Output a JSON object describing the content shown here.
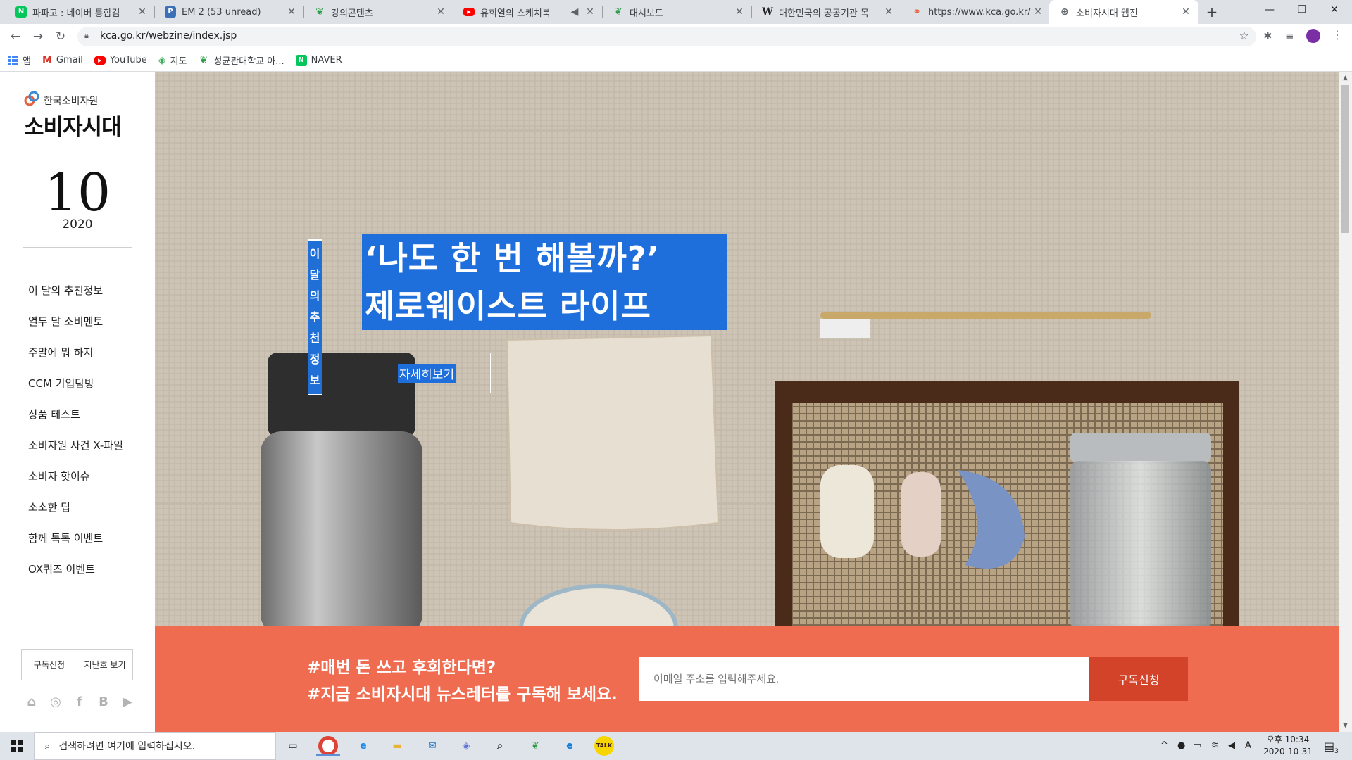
{
  "browser": {
    "tabs": [
      {
        "title": "파파고 : 네이버 통합검",
        "favicon": "naver-icon"
      },
      {
        "title": "EM 2 (53 unread)",
        "favicon": "p-icon"
      },
      {
        "title": "강의콘텐츠",
        "favicon": "leaf-icon"
      },
      {
        "title": "유희열의 스케치북",
        "favicon": "youtube-icon"
      },
      {
        "title": "대시보드",
        "favicon": "leaf-icon"
      },
      {
        "title": "대한민국의 공공기관 목",
        "favicon": "wikipedia-icon"
      },
      {
        "title": "https://www.kca.go.kr/",
        "favicon": "kca-icon"
      },
      {
        "title": "소비자시대 웹진",
        "favicon": "globe-icon",
        "active": true
      }
    ],
    "url": "kca.go.kr/webzine/index.jsp",
    "bookmarks": [
      {
        "label": "앱",
        "icon": "apps-grid-icon"
      },
      {
        "label": "Gmail",
        "icon": "gmail-icon"
      },
      {
        "label": "YouTube",
        "icon": "youtube-icon"
      },
      {
        "label": "지도",
        "icon": "maps-icon"
      },
      {
        "label": "성균관대학교 아...",
        "icon": "leaf-icon"
      },
      {
        "label": "NAVER",
        "icon": "naver-icon"
      }
    ]
  },
  "sidebar": {
    "logo_sub": "한국소비자원",
    "logo_main": "소비자시대",
    "issue_month": "10",
    "issue_year": "2020",
    "nav": [
      "이 달의 추천정보",
      "열두 달 소비멘토",
      "주말에 뭐 하지",
      "CCM 기업탐방",
      "상품 테스트",
      "소비자원 사건 X-파일",
      "소비자 핫이슈",
      "소소한 팁",
      "함께 톡톡 이벤트",
      "OX퀴즈 이벤트"
    ],
    "subscribe_label": "구독신청",
    "back_issues_label": "지난호 보기",
    "social": [
      "home-icon",
      "instagram-icon",
      "facebook-icon",
      "blog-icon",
      "youtube-icon"
    ]
  },
  "hero": {
    "vertical_label": "이달의추천정보",
    "headline_line1": "‘나도 한 번 해볼까?’",
    "headline_line2": "제로웨이스트 라이프",
    "more_label": "자세히보기"
  },
  "newsletter": {
    "line1": "#매번 돈 쓰고 후회한다면?",
    "line2": "#지금 소비자시대 뉴스레터를 구독해 보세요.",
    "email_placeholder": "이메일 주소를 입력해주세요.",
    "submit_label": "구독신청"
  },
  "taskbar": {
    "search_placeholder": "검색하려면 여기에 입력하십시오.",
    "ime": "A",
    "time": "오후 10:34",
    "date": "2020-10-31",
    "notification_count": "3"
  },
  "colors": {
    "hero_highlight": "#1e6fdc",
    "newsletter_bg": "#ef6c50",
    "newsletter_button": "#d2432a",
    "hero_bg": "#cfc6b8"
  }
}
